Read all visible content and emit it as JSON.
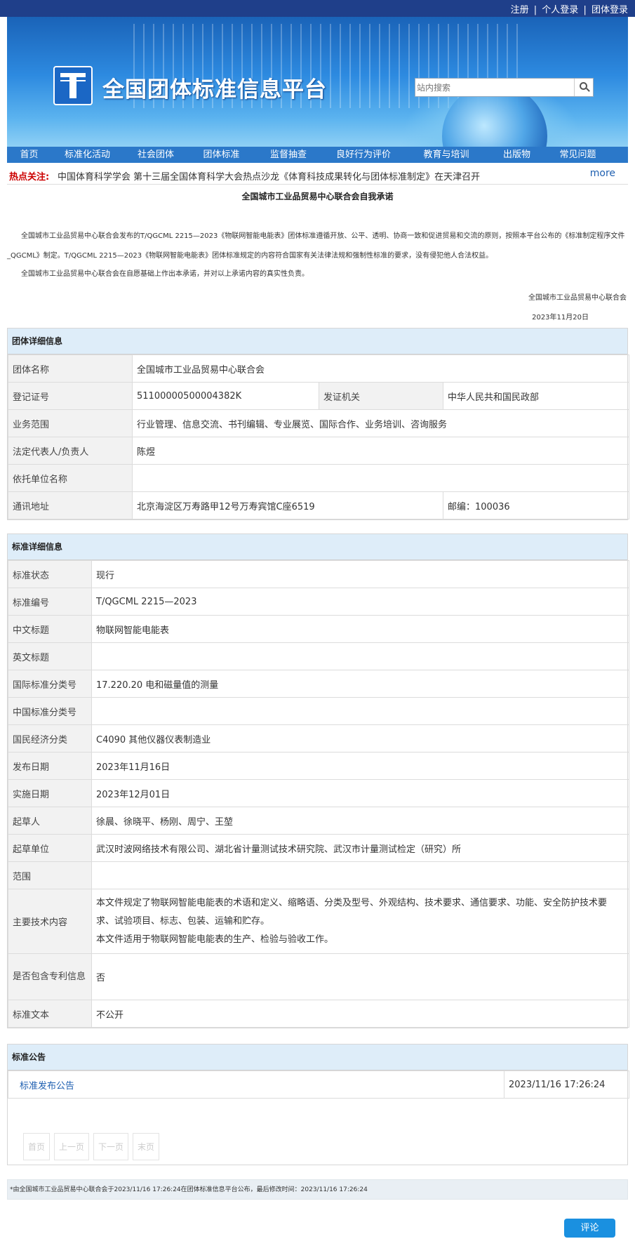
{
  "topbar": {
    "register": "注册",
    "personal_login": "个人登录",
    "group_login": "团体登录",
    "sep": "|"
  },
  "header": {
    "site_title": "全国团体标准信息平台",
    "search_placeholder": "站内搜索"
  },
  "nav": [
    "首页",
    "标准化活动",
    "社会团体",
    "团体标准",
    "监督抽查",
    "良好行为评价",
    "教育与培训",
    "出版物",
    "常见问题"
  ],
  "hot": {
    "label": "热点关注:",
    "message": "中国体育科学学会 第十三届全国体育科学大会热点沙龙《体育科技成果转化与团体标准制定》在天津召开",
    "more": "more"
  },
  "commitment": {
    "title": "全国城市工业品贸易中心联合会自我承诺",
    "para1": "全国城市工业品贸易中心联合会发布的T/QGCML 2215—2023《物联网智能电能表》团体标准遵循开放、公平、透明、协商一致和促进贸易和交流的原则，按照本平台公布的《标准制定程序文件_QGCML》制定。T/QGCML 2215—2023《物联网智能电能表》团体标准规定的内容符合国家有关法律法规和强制性标准的要求，没有侵犯他人合法权益。",
    "para2": "全国城市工业品贸易中心联合会在自愿基础上作出本承诺，并对以上承诺内容的真实性负责。",
    "signer": "全国城市工业品贸易中心联合会",
    "date": "2023年11月20日"
  },
  "group_info": {
    "header": "团体详细信息",
    "name_label": "团体名称",
    "name": "全国城市工业品贸易中心联合会",
    "reg_label": "登记证号",
    "reg": "51100000500004382K",
    "issuer_label": "发证机关",
    "issuer": "中华人民共和国民政部",
    "scope_label": "业务范围",
    "scope": "行业管理、信息交流、书刊编辑、专业展览、国际合作、业务培训、咨询服务",
    "rep_label": "法定代表人/负责人",
    "rep": "陈煜",
    "sponsor_label": "依托单位名称",
    "sponsor": "",
    "addr_label": "通讯地址",
    "addr": "北京海淀区万寿路甲12号万寿宾馆C座6519",
    "zip": "邮编：100036"
  },
  "standard_info": {
    "header": "标准详细信息",
    "rows": [
      {
        "label": "标准状态",
        "value": "现行"
      },
      {
        "label": "标准编号",
        "value": "T/QGCML 2215—2023"
      },
      {
        "label": "中文标题",
        "value": "物联网智能电能表"
      },
      {
        "label": "英文标题",
        "value": ""
      },
      {
        "label": "国际标准分类号",
        "value": "17.220.20 电和磁量值的测量"
      },
      {
        "label": "中国标准分类号",
        "value": ""
      },
      {
        "label": "国民经济分类",
        "value": "C4090 其他仪器仪表制造业"
      },
      {
        "label": "发布日期",
        "value": "2023年11月16日"
      },
      {
        "label": "实施日期",
        "value": "2023年12月01日"
      },
      {
        "label": "起草人",
        "value": "徐晨、徐晓平、杨刚、周宁、王堃"
      },
      {
        "label": "起草单位",
        "value": "武汉时波网络技术有限公司、湖北省计量测试技术研究院、武汉市计量测试检定（研究）所"
      },
      {
        "label": "范围",
        "value": ""
      }
    ],
    "tech_label": "主要技术内容",
    "tech_line1": "本文件规定了物联网智能电能表的术语和定义、缩略语、分类及型号、外观结构、技术要求、通信要求、功能、安全防护技术要求、试验项目、标志、包装、运输和贮存。",
    "tech_line2": "本文件适用于物联网智能电能表的生产、检验与验收工作。",
    "patent_label": "是否包含专利信息",
    "patent": "否",
    "text_label": "标准文本",
    "text": "不公开"
  },
  "notice": {
    "header": "标准公告",
    "link": "标准发布公告",
    "time": "2023/11/16 17:26:24",
    "pager": [
      "首页",
      "上一页",
      "下一页",
      "末页"
    ]
  },
  "footer_note": "*由全国城市工业品贸易中心联合会于2023/11/16 17:26:24在团体标准信息平台公布，最后修改时间：2023/11/16 17:26:24",
  "comment_button": "评论"
}
